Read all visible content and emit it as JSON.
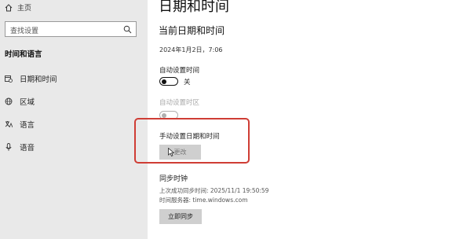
{
  "sidebar": {
    "home_label": "主页",
    "search_placeholder": "查找设置",
    "section_title": "时间和语言",
    "items": [
      {
        "label": "日期和时间",
        "icon": "calendar-clock-icon"
      },
      {
        "label": "区域",
        "icon": "globe-icon"
      },
      {
        "label": "语言",
        "icon": "language-icon"
      },
      {
        "label": "语音",
        "icon": "microphone-icon"
      }
    ]
  },
  "main": {
    "page_title": "日期和时间",
    "current_section_title": "当前日期和时间",
    "current_datetime": "2024年1月2日，7:06",
    "auto_time": {
      "label": "自动设置时间",
      "state": "关"
    },
    "auto_timezone": {
      "label": "自动设置时区"
    },
    "manual": {
      "label": "手动设置日期和时间",
      "button": "更改"
    },
    "sync": {
      "title": "同步时钟",
      "last_sync": "上次成功同步时间: 2025/11/1 19:50:59",
      "time_server": "时间服务器: time.windows.com",
      "button": "立即同步"
    }
  },
  "colors": {
    "highlight": "#cf3d35",
    "sidebar_bg": "#e9e9e9",
    "button_bg": "#cfcfcf"
  }
}
